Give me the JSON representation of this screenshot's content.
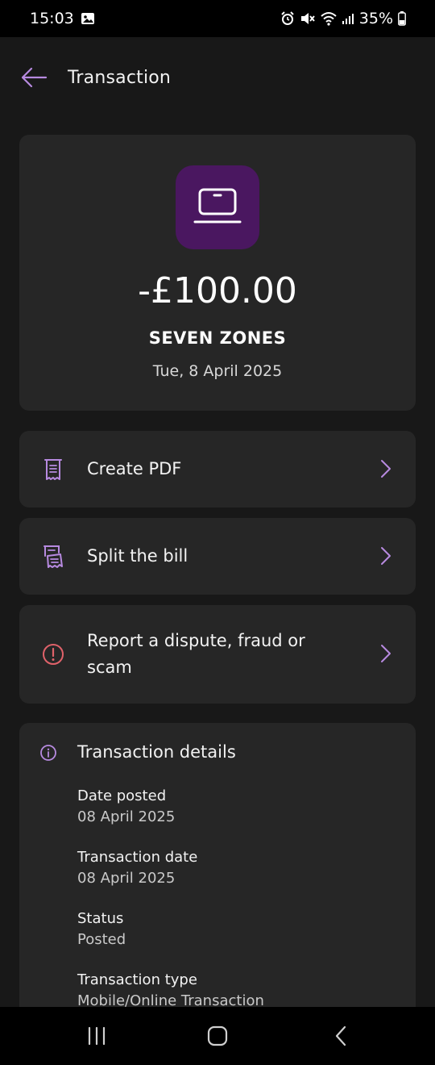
{
  "status_bar": {
    "time": "15:03",
    "battery": "35%",
    "icons": [
      "image-icon",
      "alarm-icon",
      "mute-icon",
      "wifi-icon",
      "signal-icon",
      "battery-icon"
    ]
  },
  "header": {
    "title": "Transaction",
    "back_icon": "arrow-left-icon"
  },
  "summary": {
    "amount": "-£100.00",
    "merchant": "SEVEN ZONES",
    "date": "Tue, 8 April 2025",
    "logo_icon": "laptop-icon",
    "logo_color": "#4a1760"
  },
  "actions": [
    {
      "label": "Create PDF",
      "icon": "receipt-icon"
    },
    {
      "label": "Split the bill",
      "icon": "split-bill-icon"
    },
    {
      "label": "Report a dispute, fraud or scam",
      "icon": "alert-icon"
    }
  ],
  "details": {
    "title": "Transaction details",
    "items": [
      {
        "label": "Date posted",
        "value": "08 April 2025"
      },
      {
        "label": "Transaction date",
        "value": "08 April 2025"
      },
      {
        "label": "Status",
        "value": "Posted"
      },
      {
        "label": "Transaction type",
        "value": "Mobile/Online Transaction"
      }
    ]
  },
  "colors": {
    "accent": "#b78ae0",
    "alert": "#e0626a",
    "card": "#262626",
    "background": "#181818"
  }
}
